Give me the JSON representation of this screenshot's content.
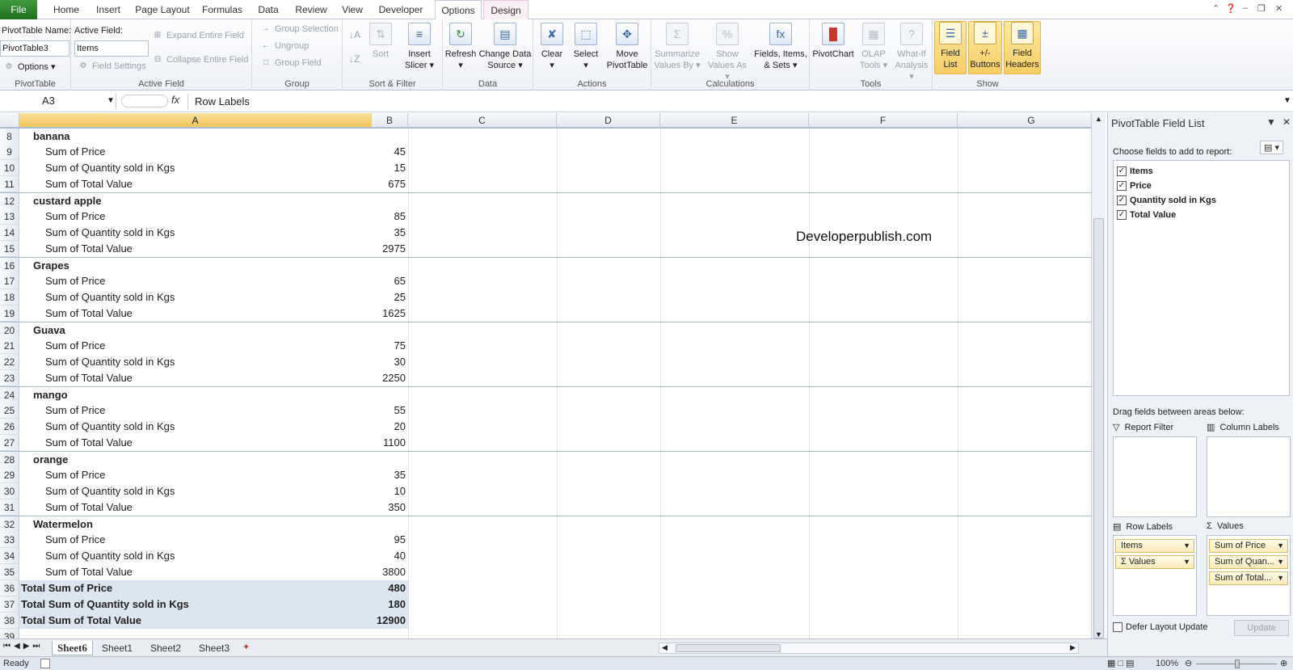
{
  "tabs": [
    "File",
    "Home",
    "Insert",
    "Page Layout",
    "Formulas",
    "Data",
    "Review",
    "View",
    "Developer",
    "Options",
    "Design"
  ],
  "ribbon": {
    "pivottable": {
      "name_label": "PivotTable Name:",
      "name_value": "PivotTable3",
      "options_label": "Options",
      "group_label": "PivotTable"
    },
    "active_field": {
      "label": "Active Field:",
      "value": "Items",
      "field_settings": "Field Settings",
      "expand": "Expand Entire Field",
      "collapse": "Collapse Entire Field",
      "group_label": "Active Field"
    },
    "group": {
      "group_selection": "Group Selection",
      "ungroup": "Ungroup",
      "group_field": "Group Field",
      "group_label": "Group"
    },
    "sort": {
      "sort": "Sort",
      "insert_slicer": "Insert Slicer",
      "group_label": "Sort & Filter"
    },
    "data": {
      "refresh": "Refresh",
      "change_source": "Change Data Source",
      "group_label": "Data"
    },
    "actions": {
      "clear": "Clear",
      "select": "Select",
      "move": "Move PivotTable",
      "group_label": "Actions"
    },
    "calculations": {
      "summarize": "Summarize Values By",
      "show_values": "Show Values As",
      "fields_items": "Fields, Items, & Sets",
      "group_label": "Calculations"
    },
    "tools": {
      "pivotchart": "PivotChart",
      "olap": "OLAP Tools",
      "whatif": "What-If Analysis",
      "group_label": "Tools"
    },
    "show": {
      "field_list": "Field List",
      "buttons": "+/- Buttons",
      "headers": "Field Headers",
      "group_label": "Show"
    }
  },
  "formula_bar": {
    "cell_ref": "A3",
    "fx": "fx",
    "content": "Row Labels"
  },
  "columns": [
    "A",
    "B",
    "C",
    "D",
    "E",
    "F",
    "G"
  ],
  "rows": [
    {
      "num": "8",
      "a": "banana",
      "b": "",
      "kind": "hdr"
    },
    {
      "num": "9",
      "a": "Sum of Price",
      "b": "45",
      "kind": "sub"
    },
    {
      "num": "10",
      "a": "Sum of Quantity sold in Kgs",
      "b": "15",
      "kind": "sub"
    },
    {
      "num": "11",
      "a": "Sum of Total Value",
      "b": "675",
      "kind": "sub"
    },
    {
      "num": "12",
      "a": "custard apple",
      "b": "",
      "kind": "hdr"
    },
    {
      "num": "13",
      "a": "Sum of Price",
      "b": "85",
      "kind": "sub"
    },
    {
      "num": "14",
      "a": "Sum of Quantity sold in Kgs",
      "b": "35",
      "kind": "sub"
    },
    {
      "num": "15",
      "a": "Sum of Total Value",
      "b": "2975",
      "kind": "sub"
    },
    {
      "num": "16",
      "a": "Grapes",
      "b": "",
      "kind": "hdr"
    },
    {
      "num": "17",
      "a": "Sum of Price",
      "b": "65",
      "kind": "sub"
    },
    {
      "num": "18",
      "a": "Sum of Quantity sold in Kgs",
      "b": "25",
      "kind": "sub"
    },
    {
      "num": "19",
      "a": "Sum of Total Value",
      "b": "1625",
      "kind": "sub"
    },
    {
      "num": "20",
      "a": "Guava",
      "b": "",
      "kind": "hdr"
    },
    {
      "num": "21",
      "a": "Sum of Price",
      "b": "75",
      "kind": "sub"
    },
    {
      "num": "22",
      "a": "Sum of Quantity sold in Kgs",
      "b": "30",
      "kind": "sub"
    },
    {
      "num": "23",
      "a": "Sum of Total Value",
      "b": "2250",
      "kind": "sub"
    },
    {
      "num": "24",
      "a": "mango",
      "b": "",
      "kind": "hdr"
    },
    {
      "num": "25",
      "a": "Sum of Price",
      "b": "55",
      "kind": "sub"
    },
    {
      "num": "26",
      "a": "Sum of Quantity sold in Kgs",
      "b": "20",
      "kind": "sub"
    },
    {
      "num": "27",
      "a": "Sum of Total Value",
      "b": "1100",
      "kind": "sub"
    },
    {
      "num": "28",
      "a": "orange",
      "b": "",
      "kind": "hdr"
    },
    {
      "num": "29",
      "a": "Sum of Price",
      "b": "35",
      "kind": "sub"
    },
    {
      "num": "30",
      "a": "Sum of Quantity sold in Kgs",
      "b": "10",
      "kind": "sub"
    },
    {
      "num": "31",
      "a": "Sum of Total Value",
      "b": "350",
      "kind": "sub"
    },
    {
      "num": "32",
      "a": "Watermelon",
      "b": "",
      "kind": "hdr"
    },
    {
      "num": "33",
      "a": "Sum of Price",
      "b": "95",
      "kind": "sub"
    },
    {
      "num": "34",
      "a": "Sum of Quantity sold in Kgs",
      "b": "40",
      "kind": "sub"
    },
    {
      "num": "35",
      "a": "Sum of Total Value",
      "b": "3800",
      "kind": "sub"
    },
    {
      "num": "36",
      "a": "Total Sum of Price",
      "b": "480",
      "kind": "tot"
    },
    {
      "num": "37",
      "a": "Total Sum of Quantity sold in Kgs",
      "b": "180",
      "kind": "tot"
    },
    {
      "num": "38",
      "a": "Total Sum of Total Value",
      "b": "12900",
      "kind": "tot"
    },
    {
      "num": "39",
      "a": "",
      "b": "",
      "kind": "empty"
    }
  ],
  "watermark": "Developerpublish.com",
  "sheet_tabs": [
    "Sheet6",
    "Sheet1",
    "Sheet2",
    "Sheet3"
  ],
  "active_sheet": "Sheet6",
  "status": "Ready",
  "zoom": "100%",
  "field_list": {
    "title": "PivotTable Field List",
    "choose_label": "Choose fields to add to report:",
    "fields": [
      {
        "name": "Items",
        "checked": true
      },
      {
        "name": "Price",
        "checked": true
      },
      {
        "name": "Quantity sold in Kgs",
        "checked": true
      },
      {
        "name": "Total Value",
        "checked": true
      }
    ],
    "drag_label": "Drag fields between areas below:",
    "report_filter": "Report Filter",
    "column_labels": "Column Labels",
    "row_labels": "Row Labels",
    "values": "Values",
    "row_chips": [
      "Items",
      "Values"
    ],
    "value_chips": [
      "Sum of Price",
      "Sum of Quan...",
      "Sum of Total..."
    ],
    "defer_label": "Defer Layout Update",
    "update_label": "Update"
  }
}
